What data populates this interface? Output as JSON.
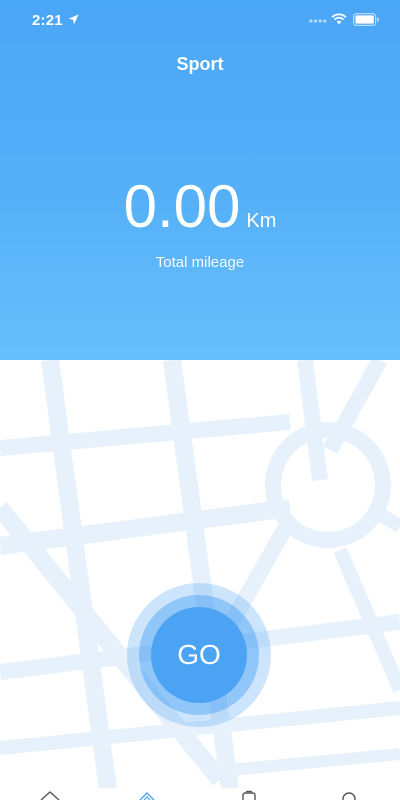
{
  "status_bar": {
    "time": "2:21",
    "icons": [
      "location-arrow-icon",
      "cellular-signal-icon",
      "wifi-icon",
      "battery-icon"
    ]
  },
  "header": {
    "title": "Sport"
  },
  "mileage": {
    "value": "0.00",
    "unit": "Km",
    "label": "Total mileage"
  },
  "actions": {
    "go_label": "GO"
  },
  "tab_bar": {
    "tabs": [
      {
        "icon": "home-icon"
      },
      {
        "icon": "sport-icon",
        "active": true
      },
      {
        "icon": "device-icon"
      },
      {
        "icon": "profile-icon"
      }
    ]
  },
  "colors": {
    "accent": "#4ca3f3",
    "header_top": "#4aa6f6",
    "header_bottom": "#66c0fb",
    "map_roads": "#e6f1fb",
    "tab_inactive": "#555555"
  }
}
